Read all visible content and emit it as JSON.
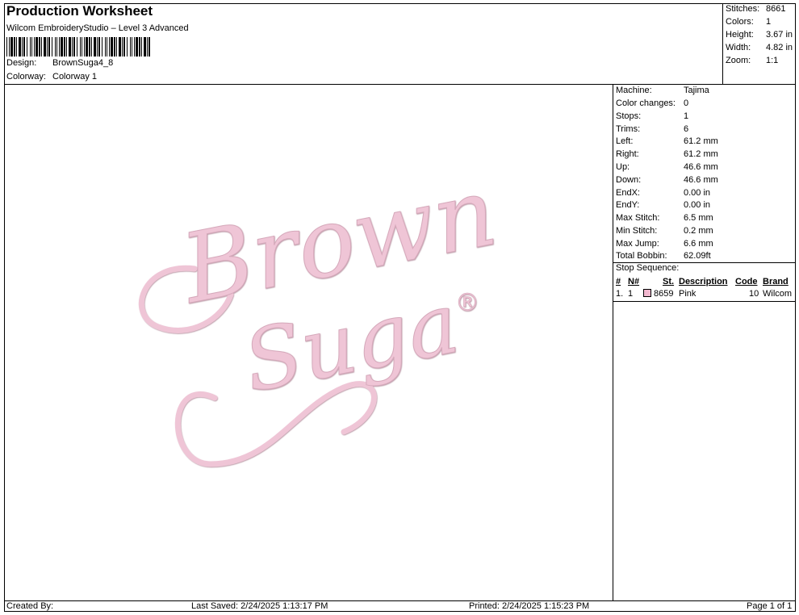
{
  "header": {
    "title": "Production Worksheet",
    "subtitle": "Wilcom EmbroideryStudio – Level 3 Advanced",
    "design_label": "Design:",
    "design_value": "BrownSuga4_8",
    "colorway_label": "Colorway:",
    "colorway_value": "Colorway 1"
  },
  "stats": [
    {
      "label": "Stitches:",
      "value": "8661"
    },
    {
      "label": "Colors:",
      "value": "1"
    },
    {
      "label": "Height:",
      "value": "3.67 in"
    },
    {
      "label": "Width:",
      "value": "4.82 in"
    },
    {
      "label": "Zoom:",
      "value": "1:1"
    }
  ],
  "machine_info": [
    {
      "label": "Machine:",
      "value": "Tajima"
    },
    {
      "label": "Color changes:",
      "value": "0"
    },
    {
      "label": "Stops:",
      "value": "1"
    },
    {
      "label": "Trims:",
      "value": "6"
    },
    {
      "label": "Left:",
      "value": "61.2 mm"
    },
    {
      "label": "Right:",
      "value": "61.2 mm"
    },
    {
      "label": "Up:",
      "value": "46.6 mm"
    },
    {
      "label": "Down:",
      "value": "46.6 mm"
    },
    {
      "label": "EndX:",
      "value": "0.00 in"
    },
    {
      "label": "EndY:",
      "value": "0.00 in"
    },
    {
      "label": "Max Stitch:",
      "value": "6.5 mm"
    },
    {
      "label": "Min Stitch:",
      "value": "0.2 mm"
    },
    {
      "label": "Max Jump:",
      "value": "6.6 mm"
    },
    {
      "label": "Total Bobbin:",
      "value": "62.09ft"
    }
  ],
  "stop_sequence": {
    "title": "Stop Sequence:",
    "headers": [
      "#",
      "N#",
      "St.",
      "Description",
      "Code",
      "Brand"
    ],
    "rows": [
      {
        "num": "1.",
        "n": "1",
        "color": "#f2b8cf",
        "stitches": "8659",
        "description": "Pink",
        "code": "10",
        "brand": "Wilcom"
      }
    ]
  },
  "design": {
    "line1": "Brown",
    "line2": "Suga",
    "mark": "®",
    "thread_color": "#efc5d6"
  },
  "footer": {
    "created_by": "Created By:",
    "last_saved": "Last Saved: 2/24/2025 1:13:17 PM",
    "printed": "Printed: 2/24/2025 1:15:23 PM",
    "page": "Page 1 of 1"
  }
}
